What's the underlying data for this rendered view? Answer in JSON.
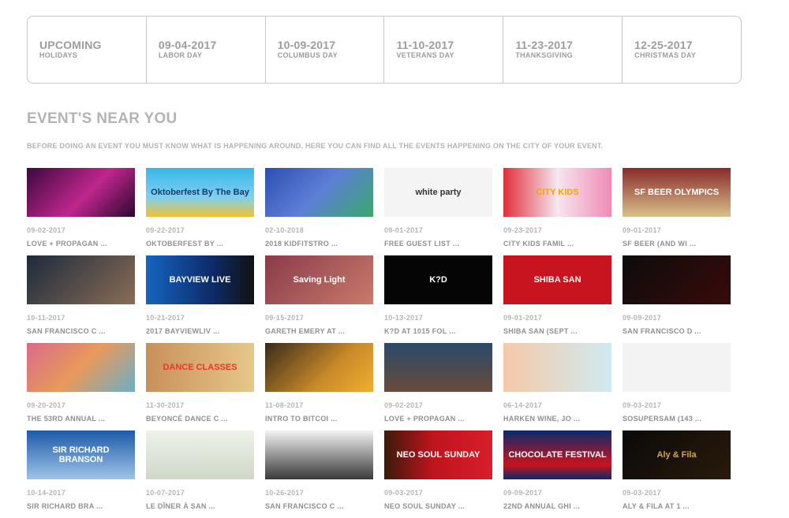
{
  "holidays": [
    {
      "date": "UPCOMING",
      "label": "HOLIDAYS"
    },
    {
      "date": "09-04-2017",
      "label": "LABOR DAY"
    },
    {
      "date": "10-09-2017",
      "label": "COLUMBUS DAY"
    },
    {
      "date": "11-10-2017",
      "label": "VETERANS DAY"
    },
    {
      "date": "11-23-2017",
      "label": "THANKSGIVING"
    },
    {
      "date": "12-25-2017",
      "label": "CHRISTMAS DAY"
    }
  ],
  "section": {
    "title": "EVENT'S NEAR YOU",
    "subtitle": "BEFORE DOING AN EVENT YOU MUST KNOW WHAT IS HAPPENING AROUND. HERE YOU CAN FIND ALL THE EVENTS HAPPENING ON THE CITY OF YOUR EVENT."
  },
  "events": [
    {
      "date": "09-02-2017",
      "title": "LOVE + PROPAGAN ...",
      "thumb": {
        "bg": "linear-gradient(135deg,#3a0a3f,#c0268c 55%,#2a0830)",
        "text": "",
        "color": "#ffffff"
      }
    },
    {
      "date": "09-22-2017",
      "title": "OKTOBERFEST BY ...",
      "thumb": {
        "bg": "linear-gradient(180deg,#39b6e8,#7ed0f0 60%,#f2c230)",
        "text": "Oktoberfest By The Bay",
        "color": "#1b3a6b"
      }
    },
    {
      "date": "02-10-2018",
      "title": "2018 KIDFITSTRO ...",
      "thumb": {
        "bg": "linear-gradient(135deg,#2d4fb0,#5e7fd6 50%,#3aa86a)",
        "text": "",
        "color": "#ffffff"
      }
    },
    {
      "date": "09-01-2017",
      "title": "FREE GUEST LIST ...",
      "thumb": {
        "bg": "#f4f4f4",
        "text": "white party",
        "color": "#333333"
      }
    },
    {
      "date": "09-23-2017",
      "title": "CITY KIDS FAMIL ...",
      "thumb": {
        "bg": "linear-gradient(90deg,#e0303a,#f6e6ef 50%,#f08bb5)",
        "text": "CITY KIDS",
        "color": "#f2a600"
      }
    },
    {
      "date": "09-01-2017",
      "title": "SF BEER (AND WI ...",
      "thumb": {
        "bg": "linear-gradient(180deg,#8a2b2b,#d9c08a)",
        "text": "SF BEER OLYMPICS",
        "color": "#ffffff"
      }
    },
    {
      "date": "10-11-2017",
      "title": "SAN FRANCISCO C ...",
      "thumb": {
        "bg": "linear-gradient(135deg,#1d2b3c,#8a6d55)",
        "text": "",
        "color": "#ffffff"
      }
    },
    {
      "date": "10-21-2017",
      "title": "2017 BAYVIEWLIV ...",
      "thumb": {
        "bg": "linear-gradient(90deg,#1565c0,#0d2c6b 60%,#111111)",
        "text": "BAYVIEW LIVE",
        "color": "#ffffff"
      }
    },
    {
      "date": "09-15-2017",
      "title": "GARETH EMERY AT ...",
      "thumb": {
        "bg": "linear-gradient(135deg,#8a3b4b,#c97a6a)",
        "text": "Saving Light",
        "color": "#ffffff"
      }
    },
    {
      "date": "10-13-2017",
      "title": "K?D AT 1015 FOL ...",
      "thumb": {
        "bg": "#050505",
        "text": "K?D",
        "color": "#ffffff"
      }
    },
    {
      "date": "09-01-2017",
      "title": "SHIBA SAN (SEPT ...",
      "thumb": {
        "bg": "#c8141e",
        "text": "SHIBA SAN",
        "color": "#ffffff"
      }
    },
    {
      "date": "09-09-2017",
      "title": "SAN FRANCISCO D ...",
      "thumb": {
        "bg": "linear-gradient(135deg,#0c0c0c,#3a0a0a)",
        "text": "",
        "color": "#ffffff"
      }
    },
    {
      "date": "09-20-2017",
      "title": "THE 53RD ANNUAL ...",
      "thumb": {
        "bg": "linear-gradient(135deg,#d96a8b,#e89a5a 50%,#6ab0c8)",
        "text": "",
        "color": "#ffffff"
      }
    },
    {
      "date": "11-30-2017",
      "title": "BEYONCÉ DANCE C ...",
      "thumb": {
        "bg": "linear-gradient(90deg,#c98f5a,#e6c88a)",
        "text": "DANCE CLASSES",
        "color": "#e23a2a"
      }
    },
    {
      "date": "11-08-2017",
      "title": "INTRO TO BITCOI ...",
      "thumb": {
        "bg": "linear-gradient(135deg,#3a2a1a,#c98a2a 60%,#f0b030)",
        "text": "",
        "color": "#ffffff"
      }
    },
    {
      "date": "09-02-2017",
      "title": "LOVE + PROPAGAN ...",
      "thumb": {
        "bg": "linear-gradient(180deg,#2a4a6a,#6a4a3a)",
        "text": "",
        "color": "#ffffff"
      }
    },
    {
      "date": "06-14-2017",
      "title": "HARKEN WINE, JO ...",
      "thumb": {
        "bg": "linear-gradient(90deg,#f6c9a8,#cfeaf2)",
        "text": "",
        "color": "#333333"
      }
    },
    {
      "date": "09-03-2017",
      "title": "SOSUPERSAM (143 ...",
      "thumb": {
        "bg": "#f3f3f3",
        "text": "",
        "color": "#111111"
      }
    },
    {
      "date": "10-14-2017",
      "title": "SIR RICHARD BRA ...",
      "thumb": {
        "bg": "linear-gradient(180deg,#1e5aa8,#9ec4e8)",
        "text": "SIR RICHARD BRANSON",
        "color": "#ffffff"
      }
    },
    {
      "date": "10-07-2017",
      "title": "LE DÎNER À SAN ...",
      "thumb": {
        "bg": "linear-gradient(180deg,#eef2ea,#cfd8c8)",
        "text": "",
        "color": "#333333"
      }
    },
    {
      "date": "10-26-2017",
      "title": "SAN FRANCISCO C ...",
      "thumb": {
        "bg": "linear-gradient(180deg,#f2f2f2,#3a3a3a)",
        "text": "",
        "color": "#ffffff"
      }
    },
    {
      "date": "09-03-2017",
      "title": "NEO SOUL SUNDAY ...",
      "thumb": {
        "bg": "linear-gradient(90deg,#3a1a0a,#c0141e 45%,#d81e2a)",
        "text": "NEO SOUL SUNDAY",
        "color": "#ffffff"
      }
    },
    {
      "date": "09-09-2017",
      "title": "22ND ANNUAL GHI ...",
      "thumb": {
        "bg": "linear-gradient(180deg,#0a2a6a,#c8141e 70%,#0a2a6a)",
        "text": "CHOCOLATE FESTIVAL",
        "color": "#ffffff"
      }
    },
    {
      "date": "09-03-2017",
      "title": "ALY & FILA AT 1 ...",
      "thumb": {
        "bg": "linear-gradient(135deg,#0a0a0a,#2a1a0a)",
        "text": "Aly & Fila",
        "color": "#d9a83a"
      }
    }
  ]
}
